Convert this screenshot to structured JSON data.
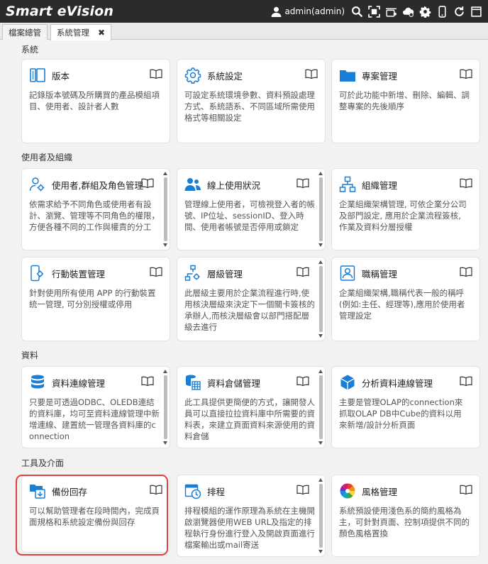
{
  "app": {
    "title": "Smart eVision",
    "user": "admin(admin)"
  },
  "tabs": [
    {
      "label": "檔案總管"
    },
    {
      "label": "系統管理",
      "close": "✖"
    }
  ],
  "sections": [
    {
      "title": "系統"
    },
    {
      "title": "使用者及組織"
    },
    {
      "title": "資料"
    },
    {
      "title": "工具及介面"
    }
  ],
  "cards": [
    {
      "title": "版本",
      "desc": "記錄版本號碼及所購買的產品模組項目、使用者、設計者人數"
    },
    {
      "title": "系統設定",
      "desc": "可設定系統環境參數、資料預設處理方式、系統語系、不同區域所需使用格式等相關設定"
    },
    {
      "title": "專案管理",
      "desc": "可於此功能中新增、刪除、編輯、調整專案的先後順序"
    },
    {
      "title": "使用者,群組及角色管理",
      "desc": "依需求給予不同角色或使用者有設計、瀏覽、管理等不同角色的權限，方便各種不同的工作與權責的分工"
    },
    {
      "title": "線上使用狀況",
      "desc": "管理線上使用者，可檢視登入者的帳號、IP位址、sessionID、登入時間、使用者帳號是否停用或鎖定"
    },
    {
      "title": "組織管理",
      "desc": "企業組織架構管理, 可依企業分公司及部門設定, 應用於企業流程簽核, 作業及資料分層授權"
    },
    {
      "title": "行動裝置管理",
      "desc": "針對使用所有使用 APP 的行動裝置統一管理, 可分別授權或停用"
    },
    {
      "title": "層級管理",
      "desc": "此層級主要用於企業流程進行時,使用核決層級來決定下一個關卡簽核的承辦人,而核決層級會以部門搭配層級去進行"
    },
    {
      "title": "職稱管理",
      "desc": "企業組織架構,職稱代表一般的稱呼(例如:主任、經理等),應用於使用者管理設定"
    },
    {
      "title": "資料連線管理",
      "desc": "只要是可透過ODBC、OLEDB連結的資料庫，均可至資料連線管理中新增連線、建置統一管理各資料庫的connection"
    },
    {
      "title": "資料倉儲管理",
      "desc": "此工具提供更簡便的方式，讓開發人員可以直接拉拉資料庫中所需要的資料表，來建立頁面資料來源使用的資料倉儲"
    },
    {
      "title": "分析資料連線管理",
      "desc": "主要是管理OLAP的connection來抓取OLAP DB中Cube的資料以用來新增/設計分析頁面"
    },
    {
      "title": "備份回存",
      "desc": "可以幫助管理者在段時間內，完成頁面規格和系統設定備份與回存"
    },
    {
      "title": "排程",
      "desc": "排程模組的運作原理為系統在主機開啟瀏覽器使用WEB URL及指定的排程執行身份進行登入及開啟頁面進行檔案輸出或mail寄送"
    },
    {
      "title": "風格管理",
      "desc": "系統預設使用淺色系的簡約風格為主，可針對頁面、控制項提供不同的顏色風格置換"
    }
  ],
  "colors": {
    "accent": "#1a7fd4",
    "topbar": "#2b2b2b",
    "highlight": "#e0403f"
  }
}
